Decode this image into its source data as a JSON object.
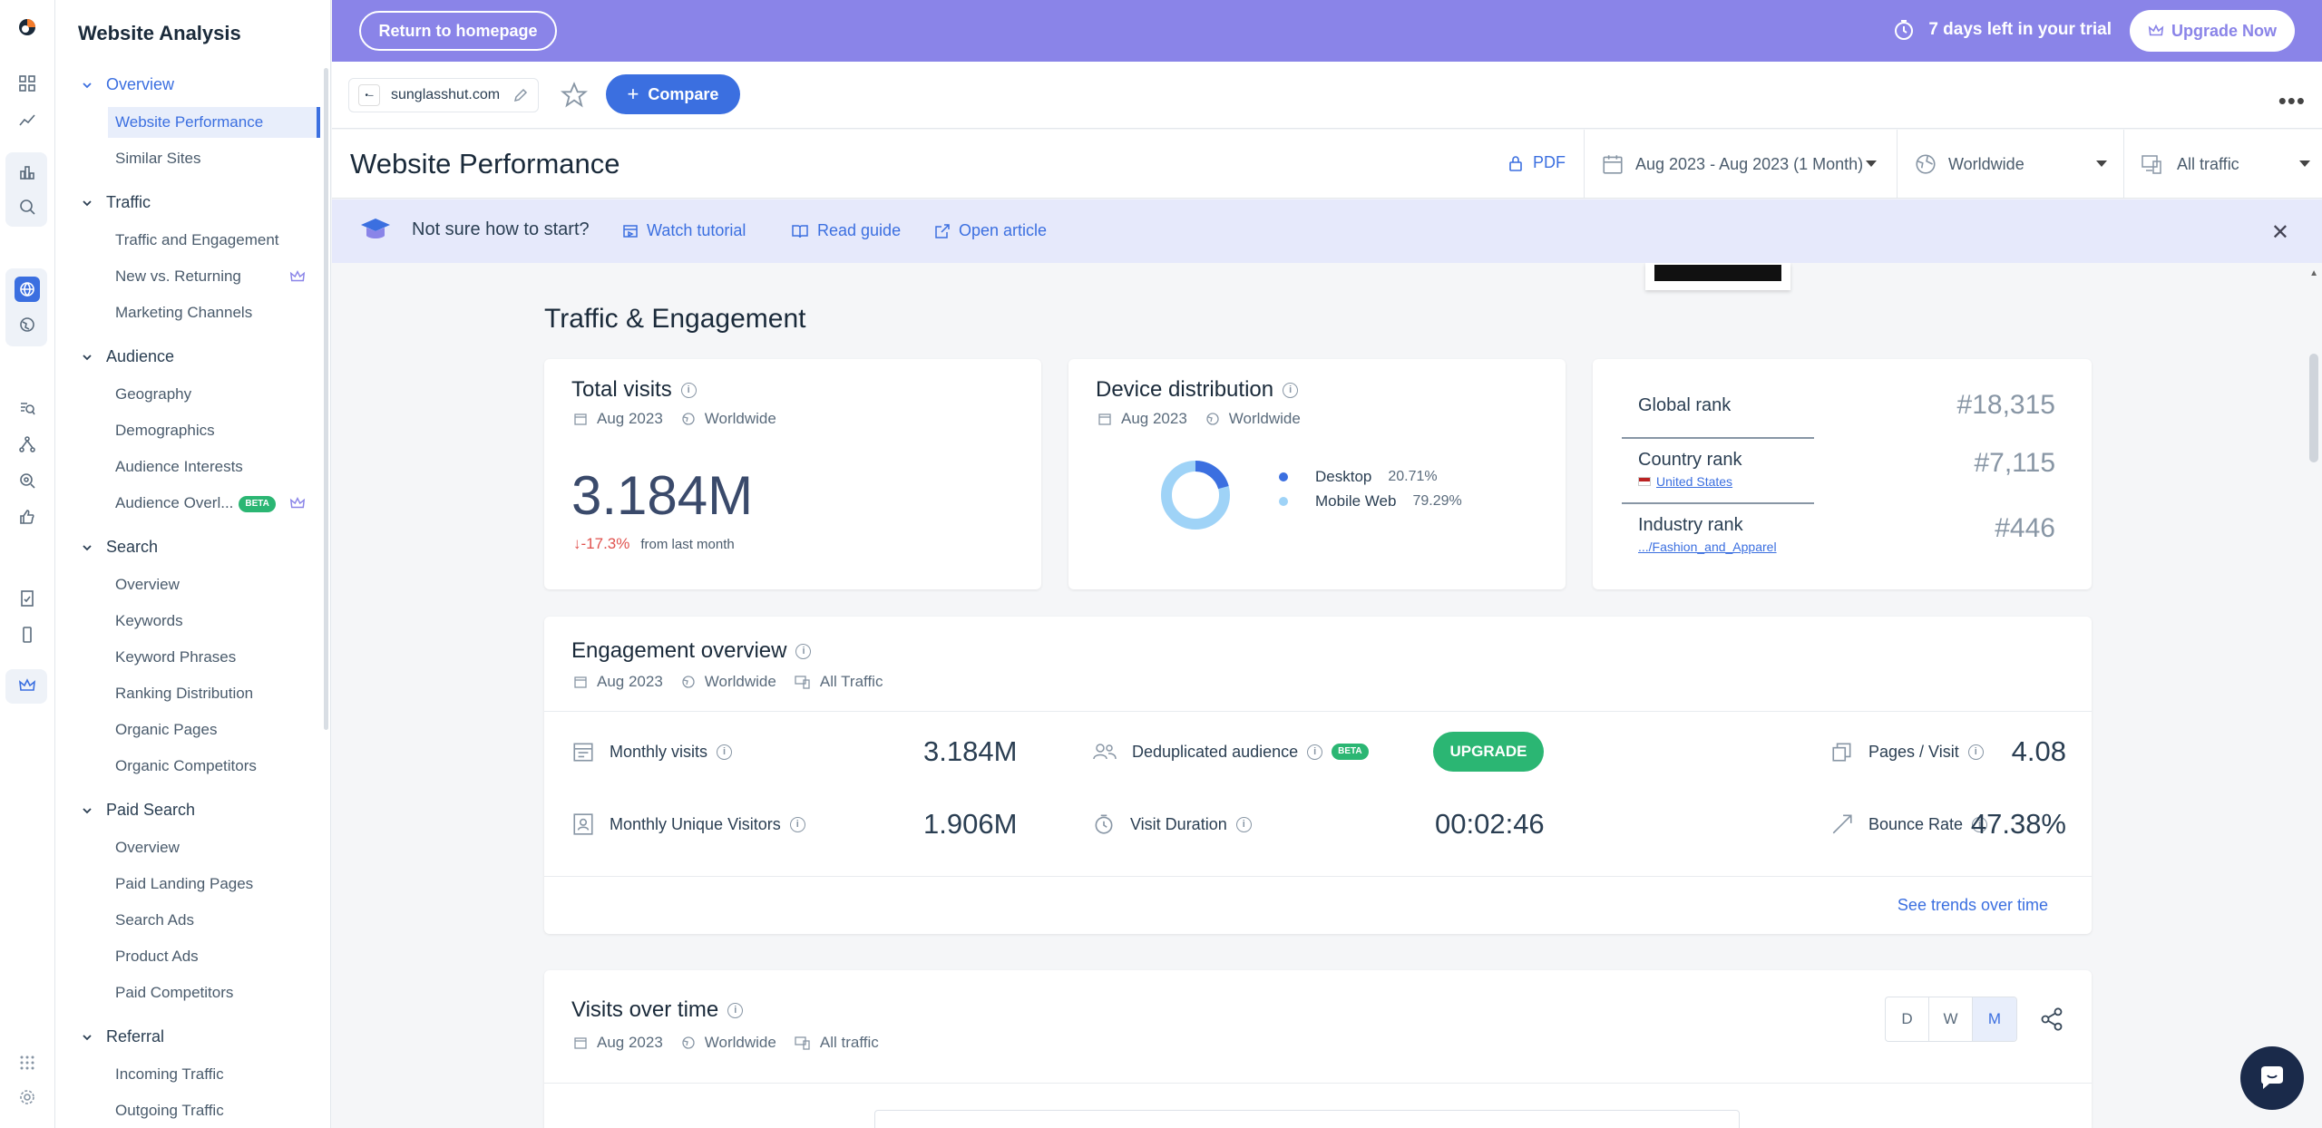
{
  "sidebar": {
    "title": "Website Analysis",
    "sections": [
      {
        "label": "Overview",
        "items": [
          "Website Performance",
          "Similar Sites"
        ]
      },
      {
        "label": "Traffic",
        "items": [
          "Traffic and Engagement",
          "New vs. Returning",
          "Marketing Channels"
        ]
      },
      {
        "label": "Audience",
        "items": [
          "Geography",
          "Demographics",
          "Audience Interests",
          "Audience Overl..."
        ]
      },
      {
        "label": "Search",
        "items": [
          "Overview",
          "Keywords",
          "Keyword Phrases",
          "Ranking Distribution",
          "Organic Pages",
          "Organic Competitors"
        ]
      },
      {
        "label": "Paid Search",
        "items": [
          "Overview",
          "Paid Landing Pages",
          "Search Ads",
          "Product Ads",
          "Paid Competitors"
        ]
      },
      {
        "label": "Referral",
        "items": [
          "Incoming Traffic",
          "Outgoing Traffic"
        ]
      }
    ],
    "beta_label": "BETA"
  },
  "topbar": {
    "return_label": "Return to homepage",
    "trial_text": "7 days left in your trial",
    "upgrade_label": "Upgrade Now"
  },
  "sitebar": {
    "domain": "sunglasshut.com",
    "compare_label": "Compare"
  },
  "titlebar": {
    "title": "Website Performance",
    "pdf_label": "PDF",
    "date_range": "Aug 2023 - Aug 2023 (1 Month)",
    "region": "Worldwide",
    "traffic": "All traffic"
  },
  "hint": {
    "text": "Not sure how to start?",
    "watch": "Watch tutorial",
    "read": "Read guide",
    "open": "Open article"
  },
  "content": {
    "section_title": "Traffic & Engagement",
    "total_visits": {
      "title": "Total visits",
      "date": "Aug 2023",
      "region": "Worldwide",
      "value": "3.184M",
      "delta": "-17.3%",
      "delta_text": "from last month"
    },
    "device": {
      "title": "Device distribution",
      "date": "Aug 2023",
      "region": "Worldwide",
      "desktop_label": "Desktop",
      "desktop_pct": "20.71%",
      "mobile_label": "Mobile Web",
      "mobile_pct": "79.29%",
      "desktop_share": 20.71,
      "desktop_color": "#3b6fe0",
      "mobile_color": "#9fd3f7"
    },
    "ranks": {
      "global_label": "Global rank",
      "global_value": "#18,315",
      "country_label": "Country rank",
      "country_sub": "United States",
      "country_value": "#7,115",
      "industry_label": "Industry rank",
      "industry_sub": ".../Fashion_and_Apparel",
      "industry_value": "#446"
    },
    "engagement": {
      "title": "Engagement overview",
      "date": "Aug 2023",
      "region": "Worldwide",
      "traffic": "All Traffic",
      "monthly_visits_label": "Monthly visits",
      "monthly_visits": "3.184M",
      "dedup_label": "Deduplicated audience",
      "dedup_badge": "BETA",
      "upgrade_label": "UPGRADE",
      "pages_visit_label": "Pages / Visit",
      "pages_visit": "4.08",
      "unique_label": "Monthly Unique Visitors",
      "unique": "1.906M",
      "duration_label": "Visit Duration",
      "duration": "00:02:46",
      "bounce_label": "Bounce Rate",
      "bounce": "47.38%",
      "see_trends": "See trends over time"
    },
    "visits_over_time": {
      "title": "Visits over time",
      "date": "Aug 2023",
      "region": "Worldwide",
      "traffic": "All traffic",
      "granularity": [
        "D",
        "W",
        "M"
      ],
      "selected": "M"
    }
  }
}
